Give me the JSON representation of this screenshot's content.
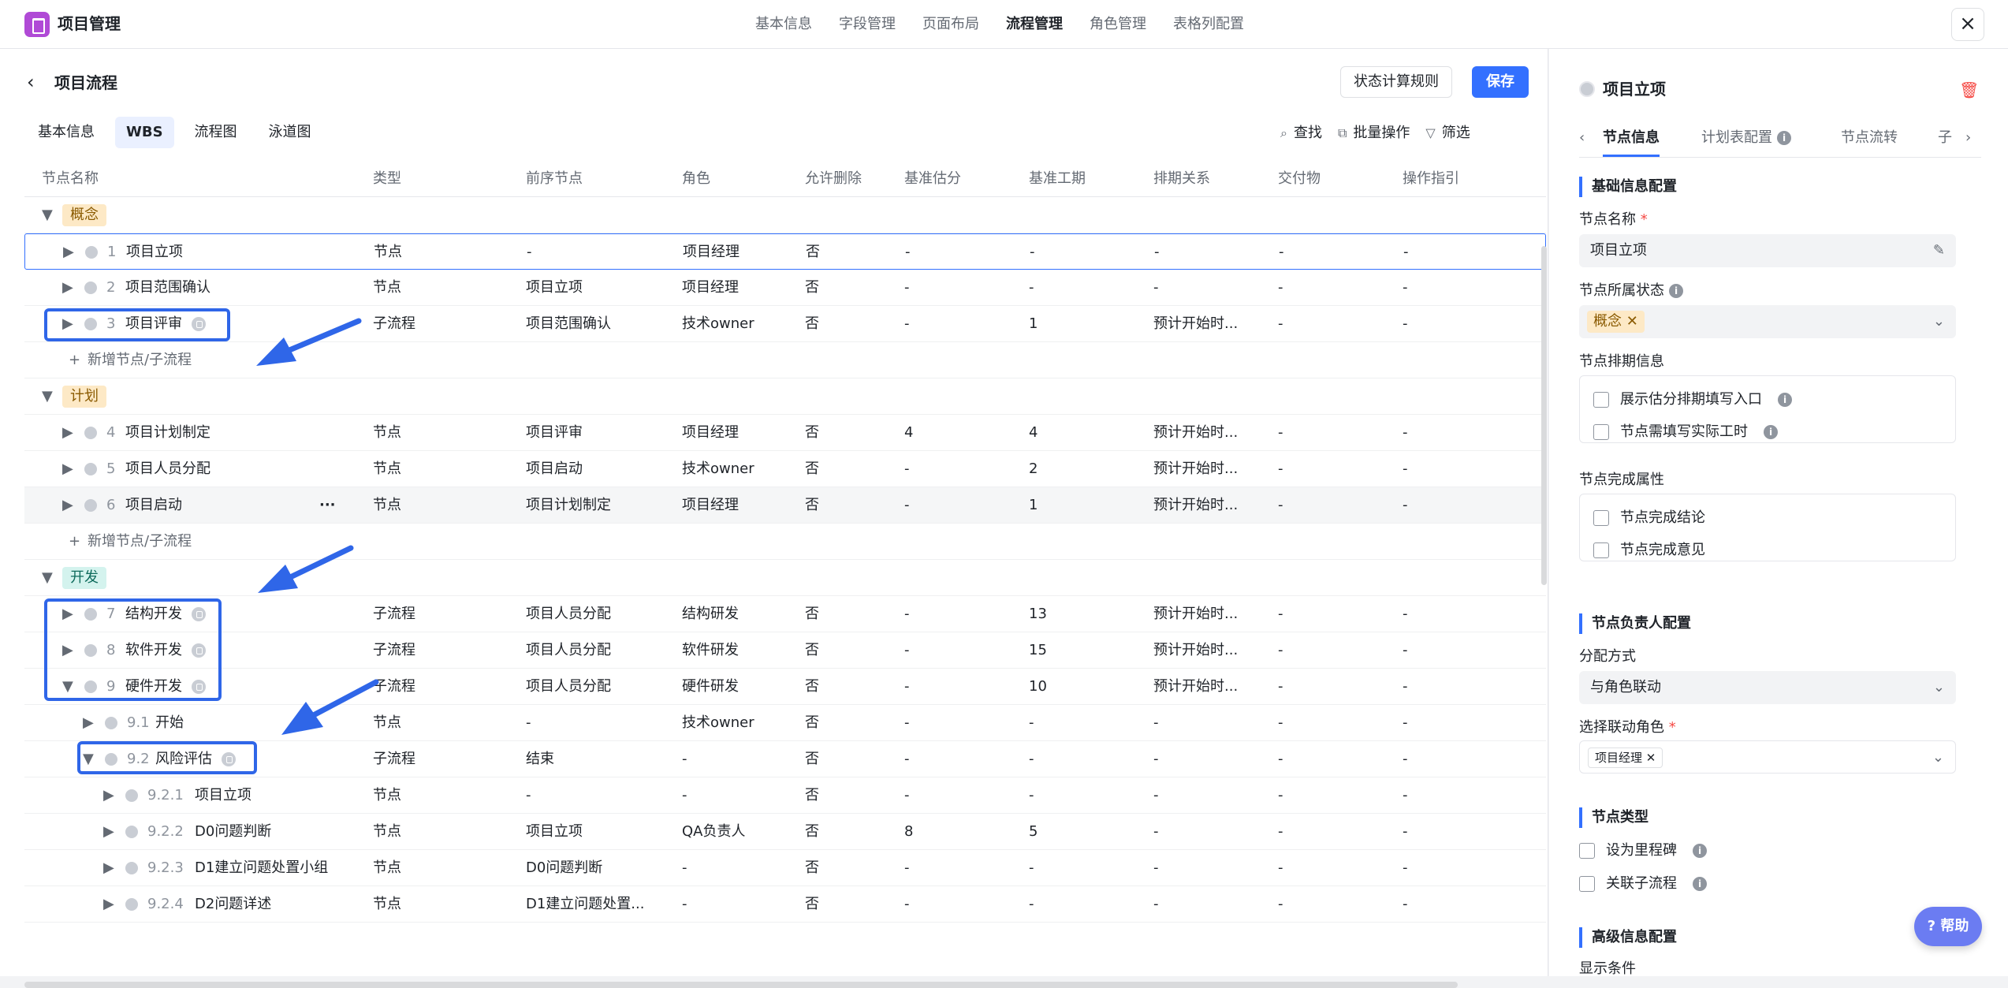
{
  "app": {
    "title": "项目管理",
    "nav": [
      "基本信息",
      "字段管理",
      "页面布局",
      "流程管理",
      "角色管理",
      "表格列配置"
    ],
    "active_nav": "流程管理"
  },
  "page": {
    "title": "项目流程",
    "rule_btn": "状态计算规则",
    "save_btn": "保存"
  },
  "subtabs": [
    "基本信息",
    "WBS",
    "流程图",
    "泳道图"
  ],
  "tools": {
    "find": "查找",
    "batch": "批量操作",
    "filter": "筛选"
  },
  "columns": [
    "节点名称",
    "类型",
    "前序节点",
    "角色",
    "允许删除",
    "基准估分",
    "基准工期",
    "排期关系",
    "交付物",
    "操作指引"
  ],
  "groups": {
    "concept": "概念",
    "plan": "计划",
    "dev": "开发"
  },
  "add_row": "新增节点/子流程",
  "more": "···",
  "rows": [
    {
      "num": "1",
      "name": "项目立项",
      "type": "节点",
      "prev": "-",
      "role": "项目经理",
      "del": "否",
      "score": "-",
      "dur": "-",
      "sched": "-",
      "deliv": "-",
      "guide": "-"
    },
    {
      "num": "2",
      "name": "项目范围确认",
      "type": "节点",
      "prev": "项目立项",
      "role": "项目经理",
      "del": "否",
      "score": "-",
      "dur": "-",
      "sched": "-",
      "deliv": "-",
      "guide": "-"
    },
    {
      "num": "3",
      "name": "项目评审",
      "type": "子流程",
      "prev": "项目范围确认",
      "role": "技术owner",
      "del": "否",
      "score": "-",
      "dur": "1",
      "sched": "预计开始时...",
      "deliv": "-",
      "guide": "-"
    },
    {
      "num": "4",
      "name": "项目计划制定",
      "type": "节点",
      "prev": "项目评审",
      "role": "项目经理",
      "del": "否",
      "score": "4",
      "dur": "4",
      "sched": "预计开始时...",
      "deliv": "-",
      "guide": "-"
    },
    {
      "num": "5",
      "name": "项目人员分配",
      "type": "节点",
      "prev": "项目启动",
      "role": "技术owner",
      "del": "否",
      "score": "-",
      "dur": "2",
      "sched": "预计开始时...",
      "deliv": "-",
      "guide": "-"
    },
    {
      "num": "6",
      "name": "项目启动",
      "type": "节点",
      "prev": "项目计划制定",
      "role": "项目经理",
      "del": "否",
      "score": "-",
      "dur": "1",
      "sched": "预计开始时...",
      "deliv": "-",
      "guide": "-"
    },
    {
      "num": "7",
      "name": "结构开发",
      "type": "子流程",
      "prev": "项目人员分配",
      "role": "结构研发",
      "del": "否",
      "score": "-",
      "dur": "13",
      "sched": "预计开始时...",
      "deliv": "-",
      "guide": "-"
    },
    {
      "num": "8",
      "name": "软件开发",
      "type": "子流程",
      "prev": "项目人员分配",
      "role": "软件研发",
      "del": "否",
      "score": "-",
      "dur": "15",
      "sched": "预计开始时...",
      "deliv": "-",
      "guide": "-"
    },
    {
      "num": "9",
      "name": "硬件开发",
      "type": "子流程",
      "prev": "项目人员分配",
      "role": "硬件研发",
      "del": "否",
      "score": "-",
      "dur": "10",
      "sched": "预计开始时...",
      "deliv": "-",
      "guide": "-"
    },
    {
      "num": "9.1",
      "name": "开始",
      "type": "节点",
      "prev": "-",
      "role": "技术owner",
      "del": "否",
      "score": "-",
      "dur": "-",
      "sched": "-",
      "deliv": "-",
      "guide": "-"
    },
    {
      "num": "9.2",
      "name": "风险评估",
      "type": "子流程",
      "prev": "结束",
      "role": "-",
      "del": "否",
      "score": "-",
      "dur": "-",
      "sched": "-",
      "deliv": "-",
      "guide": "-"
    },
    {
      "num": "9.2.1",
      "name": "项目立项",
      "type": "节点",
      "prev": "-",
      "role": "-",
      "del": "否",
      "score": "-",
      "dur": "-",
      "sched": "-",
      "deliv": "-",
      "guide": "-"
    },
    {
      "num": "9.2.2",
      "name": "D0问题判断",
      "type": "节点",
      "prev": "项目立项",
      "role": "QA负责人",
      "del": "否",
      "score": "8",
      "dur": "5",
      "sched": "-",
      "deliv": "-",
      "guide": "-"
    },
    {
      "num": "9.2.3",
      "name": "D1建立问题处置小组",
      "type": "节点",
      "prev": "D0问题判断",
      "role": "-",
      "del": "否",
      "score": "-",
      "dur": "-",
      "sched": "-",
      "deliv": "-",
      "guide": "-"
    },
    {
      "num": "9.2.4",
      "name": "D2问题详述",
      "type": "节点",
      "prev": "D1建立问题处置...",
      "role": "-",
      "del": "否",
      "score": "-",
      "dur": "-",
      "sched": "-",
      "deliv": "-",
      "guide": "-"
    }
  ],
  "panel": {
    "title": "项目立项",
    "tabs": [
      "节点信息",
      "计划表配置",
      "节点流转",
      "子"
    ],
    "sec_basic": "基础信息配置",
    "name_label": "节点名称",
    "name_value": "项目立项",
    "state_label": "节点所属状态",
    "state_chip": "概念",
    "sched_label": "节点排期信息",
    "sched_opts": [
      "展示估分排期填写入口",
      "节点需填写实际工时"
    ],
    "done_label": "节点完成属性",
    "done_opts": [
      "节点完成结论",
      "节点完成意见"
    ],
    "sec_owner": "节点负责人配置",
    "assign_label": "分配方式",
    "assign_value": "与角色联动",
    "role_label": "选择联动角色",
    "role_chip": "项目经理",
    "sec_type": "节点类型",
    "type_opts": [
      "设为里程碑",
      "关联子流程"
    ],
    "sec_adv": "高级信息配置",
    "adv_sub": "显示条件"
  },
  "help": "帮助",
  "colors": {
    "accent": "#3370ff",
    "concept_bg": "#fde9c6",
    "plan_bg": "#fde9c6",
    "dev_bg": "#d4f3ee",
    "annot": "#2f66e8"
  }
}
